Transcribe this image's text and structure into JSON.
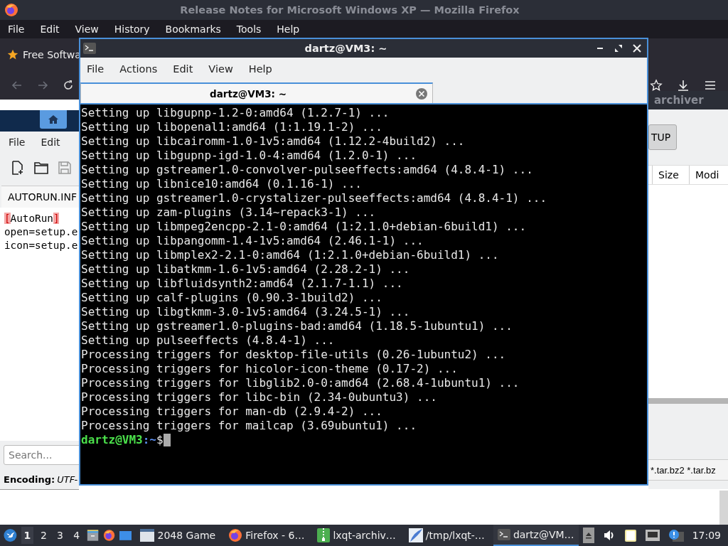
{
  "browser": {
    "title": "Release Notes for Microsoft Windows XP — Mozilla Firefox",
    "menu": [
      "File",
      "Edit",
      "View",
      "History",
      "Bookmarks",
      "Tools",
      "Help"
    ],
    "bookmark": "Free Softwa"
  },
  "editor": {
    "menu": [
      "File",
      "Edit"
    ],
    "tab": "AUTORUN.INF",
    "lines": [
      {
        "kind": "section",
        "text": "[AutoRun]"
      },
      {
        "kind": "plain",
        "text": "open=setup.e"
      },
      {
        "kind": "plain",
        "text": "icon=setup.e"
      }
    ],
    "search": {
      "placeholder": "Search..."
    },
    "status": {
      "label": "Encoding:",
      "value": "UTF-"
    }
  },
  "archiver": {
    "title": "archiver",
    "button": "TUP",
    "columns": [
      "Size",
      "Modi"
    ],
    "filter": "*.tar.bz2 *.tar.bz"
  },
  "terminal": {
    "title": "dartz@VM3: ~",
    "menu": [
      "File",
      "Actions",
      "Edit",
      "View",
      "Help"
    ],
    "tab": {
      "label": "dartz@VM3: ~",
      "selected": true
    },
    "lines": [
      "Setting up libgupnp-1.2-0:amd64 (1.2.7-1) ...",
      "Setting up libopenal1:amd64 (1:1.19.1-2) ...",
      "Setting up libcairomm-1.0-1v5:amd64 (1.12.2-4build2) ...",
      "Setting up libgupnp-igd-1.0-4:amd64 (1.2.0-1) ...",
      "Setting up gstreamer1.0-convolver-pulseeffects:amd64 (4.8.4-1) ...",
      "Setting up libnice10:amd64 (0.1.16-1) ...",
      "Setting up gstreamer1.0-crystalizer-pulseeffects:amd64 (4.8.4-1) ...",
      "Setting up zam-plugins (3.14~repack3-1) ...",
      "Setting up libmpeg2encpp-2.1-0:amd64 (1:2.1.0+debian-6build1) ...",
      "Setting up libpangomm-1.4-1v5:amd64 (2.46.1-1) ...",
      "Setting up libmplex2-2.1-0:amd64 (1:2.1.0+debian-6build1) ...",
      "Setting up libatkmm-1.6-1v5:amd64 (2.28.2-1) ...",
      "Setting up libfluidsynth2:amd64 (2.1.7-1.1) ...",
      "Setting up calf-plugins (0.90.3-1build2) ...",
      "Setting up libgtkmm-3.0-1v5:amd64 (3.24.5-1) ...",
      "Setting up gstreamer1.0-plugins-bad:amd64 (1.18.5-1ubuntu1) ...",
      "Setting up pulseeffects (4.8.4-1) ...",
      "Processing triggers for desktop-file-utils (0.26-1ubuntu2) ...",
      "Processing triggers for hicolor-icon-theme (0.17-2) ...",
      "Processing triggers for libglib2.0-0:amd64 (2.68.4-1ubuntu1) ...",
      "Processing triggers for libc-bin (2.34-0ubuntu3) ...",
      "Processing triggers for man-db (2.9.4-2) ...",
      "Processing triggers for mailcap (3.69ubuntu1) ..."
    ],
    "prompt": {
      "user": "dartz@VM3",
      "path": ":~",
      "symbol": "$"
    }
  },
  "taskbar": {
    "desktops": [
      {
        "label": "1",
        "selected": true
      },
      {
        "label": "2",
        "selected": false
      },
      {
        "label": "3",
        "selected": false
      },
      {
        "label": "4",
        "selected": false
      }
    ],
    "tasks": [
      {
        "label": "2048 Game",
        "kind": "window",
        "selected": false
      },
      {
        "label": "Firefox - 6…",
        "kind": "firefox",
        "selected": false
      },
      {
        "label": "lxqt-archiv…",
        "kind": "archive",
        "selected": false
      },
      {
        "label": "/tmp/lxqt-…",
        "kind": "editor",
        "selected": false
      },
      {
        "label": "dartz@VM…",
        "kind": "terminal",
        "selected": true
      }
    ],
    "clock": "17:09"
  }
}
